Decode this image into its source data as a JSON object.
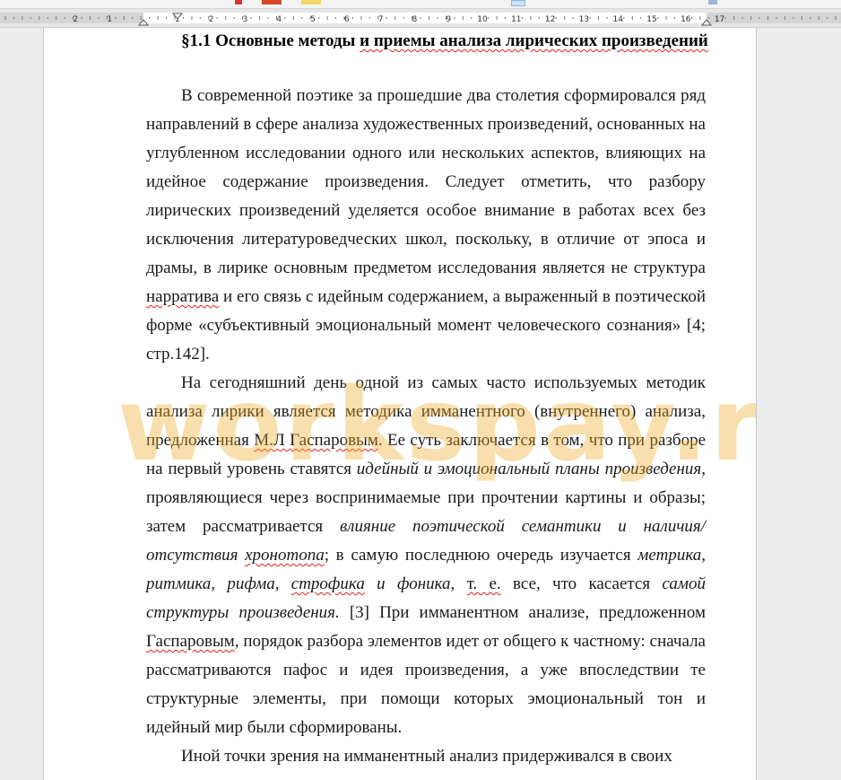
{
  "ruler": {
    "left_labels": [
      "2",
      "1"
    ],
    "labels": [
      "1",
      "2",
      "3",
      "4",
      "5",
      "6",
      "7",
      "8",
      "9",
      "10",
      "11",
      "12",
      "13",
      "14",
      "15",
      "16",
      "17"
    ]
  },
  "document": {
    "heading_prefix": "§1.1 Основные методы ",
    "heading_flagged": "и приемы анализа лирических произведений",
    "p1_a": "В современной поэтике за прошедшие два столетия сформировался ряд направлений в сфере анализа художественных произведений, основанных на углубленном исследовании одного или нескольких аспектов, влияющих на идейное содержание произведения. Следует отметить, что разбору лирических произведений уделяется особое внимание в работах всех без исключения литературоведческих школ, поскольку, в отличие от эпоса и драмы, в лирике основным предметом исследования является не структура ",
    "p1_flag": "нарратива",
    "p1_b": " и его связь с идейным содержанием, а выраженный в поэтической форме «субъективный эмоциональный момент человеческого сознания» [4; стр.142].",
    "p2_a": "На сегодняшний день одной из самых часто используемых методик анализа лирики является методика имманентного (внутреннего) анализа, предложенная ",
    "p2_flag1": "М.Л Гаспаровым",
    "p2_b": ". Ее суть заключается в том, что при разборе на первый уровень ставятся ",
    "p2_it1": "идейный и эмоциональный планы произведения",
    "p2_c": ", проявляющиеся через воспринимаемые при прочтении картины и образы; затем рассматривается ",
    "p2_it2": "влияние поэтической семантики и наличия/отсутствия ",
    "p2_it2_flag": "хронотопа",
    "p2_d": "; в самую последнюю очередь изучается ",
    "p2_it3": "метрика, ритмика, рифма, ",
    "p2_it3_flag": "строфика",
    "p2_it3b": " и фоника",
    "p2_e": ", ",
    "p2_flag2": "т. е.",
    "p2_f": " все, что касается ",
    "p2_it4": "самой структуры произведения.",
    "p2_g": " [3] При имманентном анализе, предложенном ",
    "p2_flag3": "Гаспаровым",
    "p2_h": ", порядок разбора элементов идет от общего к частному: сначала рассматриваются пафос и идея произведения, а уже впоследствии те структурные элементы, при помощи которых эмоциональный тон и идейный мир были сформированы.",
    "p3_a": "Иной точки зрения на имманентный анализ придерживался в своих"
  },
  "watermark": {
    "text": "workspay.ru",
    "color": "#f0aa28"
  },
  "colors": {
    "spell_error": "#e0201e",
    "ruler_bg": "#e6e6e6",
    "page_bg": "#ffffff"
  }
}
